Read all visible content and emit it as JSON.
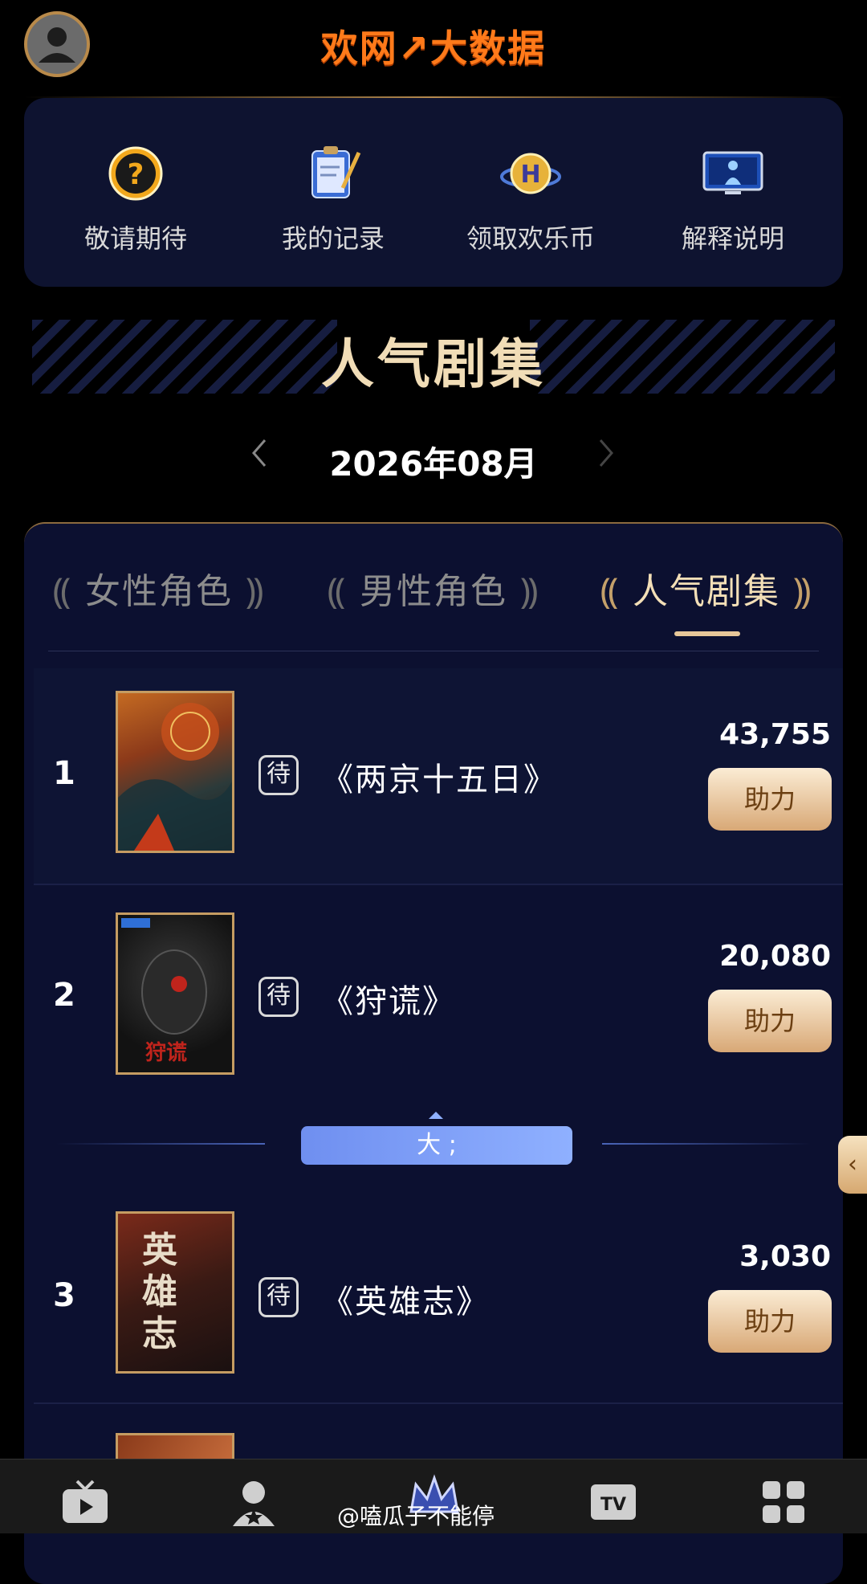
{
  "header": {
    "brand": "欢网↗大数据"
  },
  "top_menu": [
    {
      "label": "敬请期待",
      "icon": "question-icon"
    },
    {
      "label": "我的记录",
      "icon": "notepad-icon"
    },
    {
      "label": "领取欢乐币",
      "icon": "h-coin-icon"
    },
    {
      "label": "解释说明",
      "icon": "tv-screen-icon"
    }
  ],
  "banner": {
    "title": "人气剧集"
  },
  "month": {
    "label": "2026年08月"
  },
  "tabs": [
    {
      "label": "女性角色",
      "active": false
    },
    {
      "label": "男性角色",
      "active": false
    },
    {
      "label": "人气剧集",
      "active": true
    }
  ],
  "ranking": [
    {
      "rank": "1",
      "status": "待",
      "title": "《两京十五日》",
      "score": "43,755",
      "button": "助力"
    },
    {
      "rank": "2",
      "status": "待",
      "title": "《狩谎》",
      "score": "20,080",
      "button": "助力"
    },
    {
      "rank": "3",
      "status": "待",
      "title": "《英雄志》",
      "score": "3,030",
      "button": "助力"
    }
  ],
  "divider": {
    "label": "大 ;"
  },
  "side_tab": {
    "label": "‹"
  },
  "bottom_nav": [
    {
      "icon": "tv-play-icon"
    },
    {
      "icon": "user-star-icon"
    },
    {
      "icon": "crown-icon"
    },
    {
      "icon": "tv-text-icon"
    },
    {
      "icon": "grid-apps-icon"
    }
  ],
  "watermark": "@嗑瓜子不能停",
  "colors": {
    "accent_gold": "#e7c799",
    "panel_bg": "#0c1030",
    "brand_orange": "#ff7a1a"
  }
}
